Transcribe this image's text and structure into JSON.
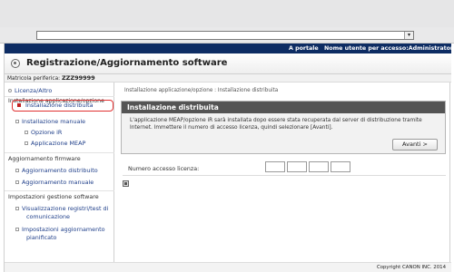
{
  "browser": {
    "address_dropdown": "▾"
  },
  "topbar": {
    "portal_link": "A portale",
    "user_label": "Nome utente per accesso:Administrator Esci"
  },
  "header": {
    "title": "Registrazione/Aggiornamento software"
  },
  "serial": {
    "label": "Matricola periferica:",
    "value": "ZZZ99999"
  },
  "sidebar": {
    "license": "Licenza/Altro",
    "install_section": "Installazione applicazione/opzione",
    "install_distributed": "Installazione distribuita",
    "install_manual": "Installazione manuale",
    "option_ir": "Opzione iR",
    "meap_app": "Applicazione MEAP",
    "firmware_section": "Aggiornamento firmware",
    "firmware_distributed": "Aggiornamento distribuito",
    "firmware_manual": "Aggiornamento manuale",
    "settings_section": "Impostazioni gestione software",
    "view_logs_line1": "Visualizzazione registri/test di",
    "view_logs_line2": "comunicazione",
    "update_settings_line1": "Impostazioni aggiornamento",
    "update_settings_line2": "pianificato"
  },
  "main": {
    "breadcrumb": "Installazione applicazione/opzione : Installazione distribuita",
    "panel_title": "Installazione distribuita",
    "panel_text": "L'applicazione MEAP/opzione iR sarà installata dopo essere stata recuperata dal server di distribuzione tramite Internet. Immettere il numero di accesso licenza, quindi selezionare [Avanti].",
    "next_button": "Avanti >",
    "license_label": "Numero accesso licenza:",
    "license_values": [
      "",
      "",
      "",
      ""
    ]
  },
  "footer": {
    "copyright": "Copyright CANON INC. 2014"
  },
  "colors": {
    "topbar": "#0d2c63",
    "panel_title": "#545454",
    "highlight": "#e03030",
    "link": "#1f3f8a"
  }
}
